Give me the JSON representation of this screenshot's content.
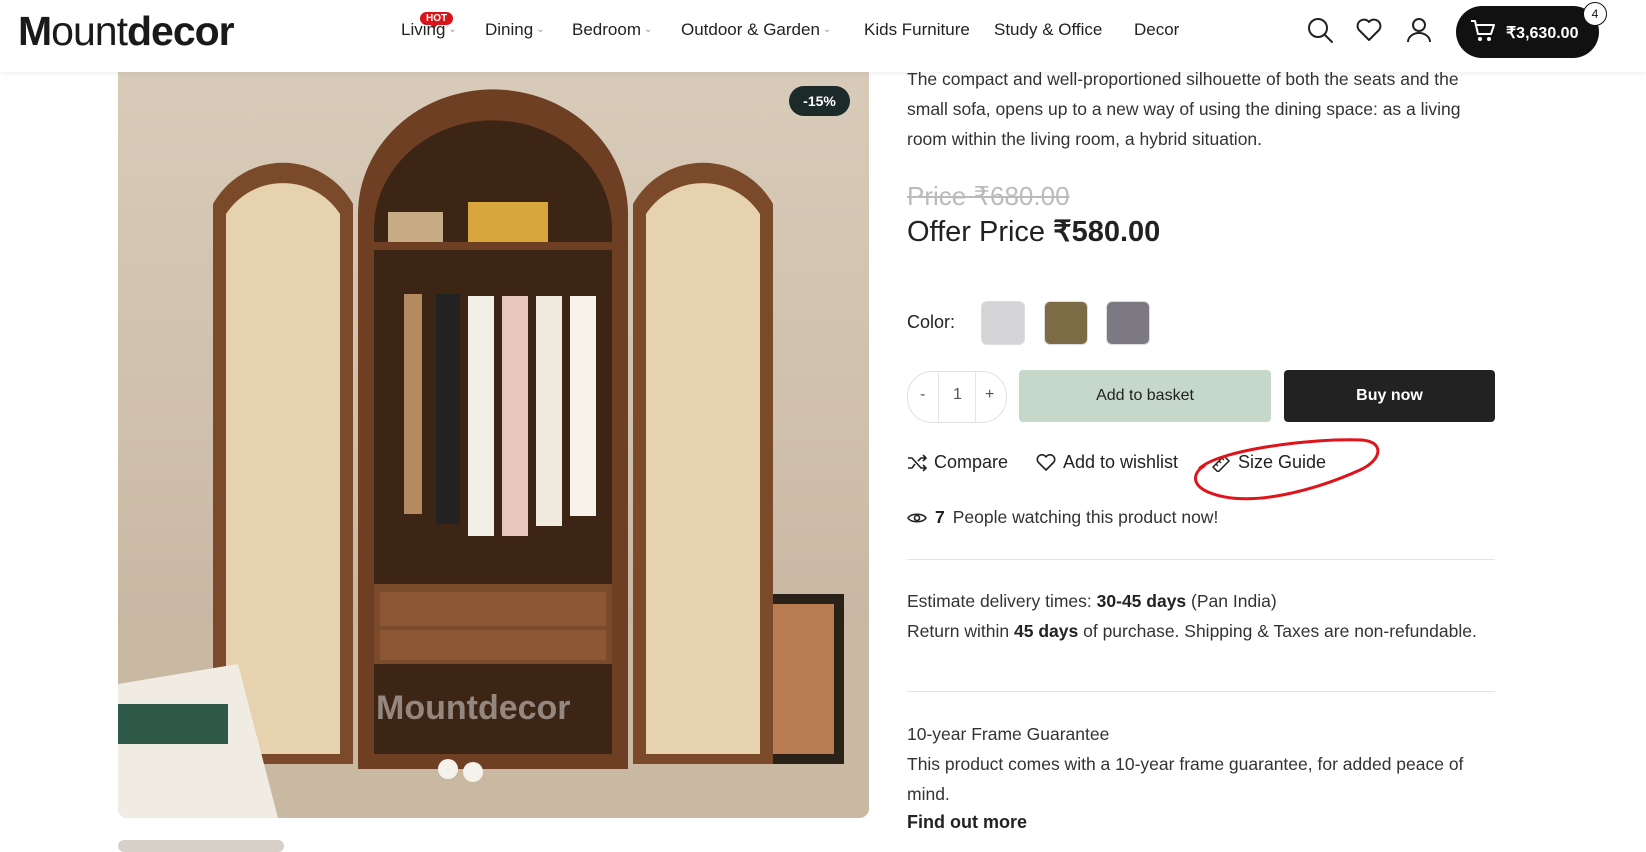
{
  "header": {
    "logo": {
      "m": "M",
      "ount": "ount",
      "decor": "decor"
    },
    "nav": [
      {
        "label": "Living",
        "has_dropdown": true,
        "badge": "HOT"
      },
      {
        "label": "Dining",
        "has_dropdown": true
      },
      {
        "label": "Bedroom",
        "has_dropdown": true
      },
      {
        "label": "Outdoor & Garden",
        "has_dropdown": true
      },
      {
        "label": "Kids Furniture",
        "has_dropdown": false
      },
      {
        "label": "Study & Office",
        "has_dropdown": false
      },
      {
        "label": "Decor",
        "has_dropdown": false
      }
    ],
    "icons": [
      "search-icon",
      "heart-icon",
      "user-icon"
    ],
    "cart": {
      "amount": "₹3,630.00",
      "count": "4"
    }
  },
  "product": {
    "discount_badge": "-15%",
    "watermark": "Mountdecor",
    "description": "The compact and well-proportioned silhouette of both the seats and the small sofa, opens up to a new way of using the dining space: as a living room within the living room, a hybrid situation.",
    "old_price": "Price ₹680.00",
    "offer_label": "Offer Price",
    "offer_price": "₹580.00",
    "color_label": "Color:",
    "colors": [
      "#d4d4d6",
      "#7b6c45",
      "#7c7983"
    ],
    "quantity": {
      "minus": "-",
      "value": "1",
      "plus": "+"
    },
    "add_to_basket": "Add to basket",
    "buy_now": "Buy now",
    "actions": {
      "compare": "Compare",
      "wishlist": "Add to wishlist",
      "size_guide": "Size Guide"
    },
    "watching": {
      "count": "7",
      "text": "People watching this product now!"
    },
    "delivery": {
      "label": "Estimate delivery times:",
      "days": "30-45 days",
      "region": "(Pan India)",
      "return_prefix": "Return within",
      "return_days": "45 days",
      "return_suffix": "of purchase. Shipping & Taxes are non-refundable."
    },
    "guarantee": {
      "title": "10-year Frame Guarantee",
      "text": "This product comes with a 10-year frame guarantee, for added peace of mind.",
      "link": "Find out more"
    }
  },
  "colors": {
    "accent_green": "#c5d8c9",
    "dark": "#222222",
    "hot_red": "#d9141a",
    "annotation_red": "#e0121a"
  }
}
